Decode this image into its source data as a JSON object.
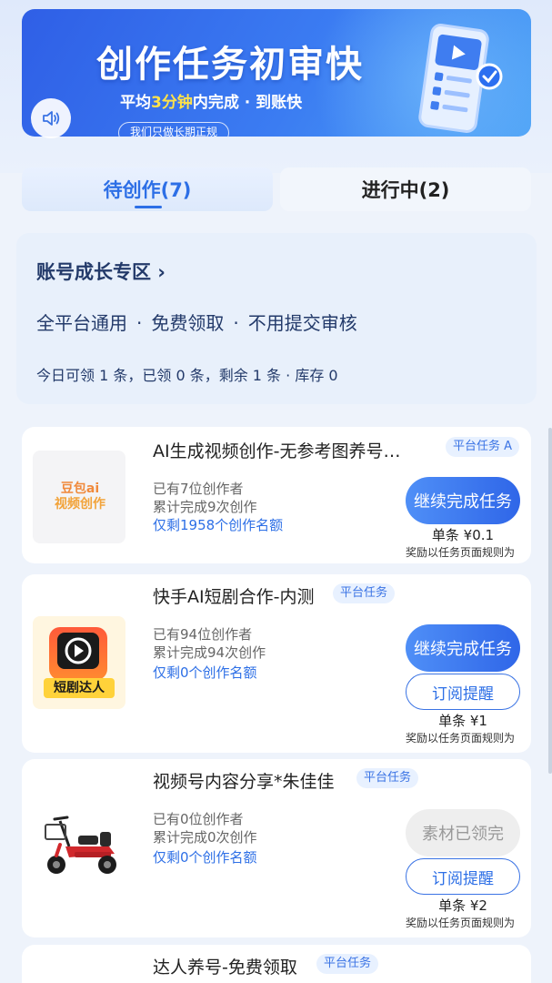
{
  "banner": {
    "title": "创作任务初审快",
    "subtitle_prefix": "平均",
    "subtitle_highlight": "3分钟",
    "subtitle_suffix": "内完成 · 到账快",
    "pill": "我们只做长期正规",
    "sound_icon": "speaker-icon",
    "illustration": "phone-checklist-illustration"
  },
  "tabs": [
    {
      "label": "待创作(7)",
      "active": true
    },
    {
      "label": "进行中(2)",
      "active": false
    }
  ],
  "growth": {
    "title": "账号成长专区 ›",
    "features": [
      "全平台通用",
      "免费领取",
      "不用提交审核"
    ],
    "feature_separator": "·",
    "stats": "今日可领 1 条，已领 0 条，剩余 1 条 · 库存 0"
  },
  "tasks": [
    {
      "title": "AI生成视频创作-无参考图养号…",
      "tag": "平台任务 A",
      "creators": "已有7位创作者",
      "completed": "累计完成9次创作",
      "remaining": "仅剩1958个创作名额",
      "primary_button": "继续完成任务",
      "price": "单条 ¥0.1",
      "note": "奖励以任务页面规则为",
      "thumb_text_1": "豆包ai",
      "thumb_text_2": "视频创作"
    },
    {
      "title": "快手AI短剧合作-内测",
      "tag": "平台任务",
      "creators": "已有94位创作者",
      "completed": "累计完成94次创作",
      "remaining": "仅剩0个创作名额",
      "primary_button": "继续完成任务",
      "secondary_button": "订阅提醒",
      "price": "单条 ¥1",
      "note": "奖励以任务页面规则为",
      "thumb_text": "短剧达人"
    },
    {
      "title": "视频号内容分享*朱佳佳",
      "tag": "平台任务",
      "creators": "已有0位创作者",
      "completed": "累计完成0次创作",
      "remaining": "仅剩0个创作名额",
      "disabled_button": "素材已领完",
      "secondary_button": "订阅提醒",
      "price": "单条 ¥2",
      "note": "奖励以任务页面规则为"
    },
    {
      "title": "达人养号-免费领取",
      "tag": "平台任务"
    }
  ],
  "colors": {
    "accent": "#2d6fe6",
    "banner": "#3b7cf2",
    "highlight": "#ffe24a",
    "page_bg": "#eef3fb"
  }
}
